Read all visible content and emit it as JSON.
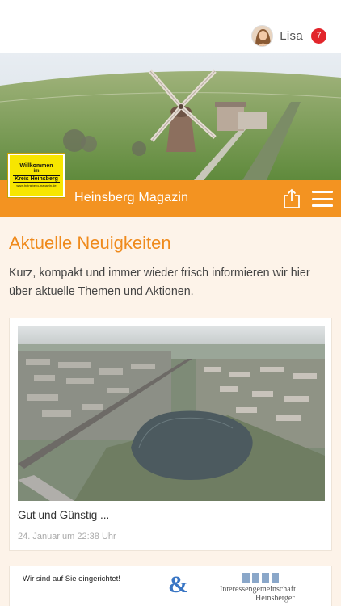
{
  "user": {
    "name": "Lisa",
    "notifications": "7"
  },
  "header": {
    "title": "Heinsberg Magazin",
    "logo": {
      "line1": "Willkommen",
      "line2": "im",
      "line3": "Kreis Heinsberg",
      "line4": "www.heinsberg-magazin.de"
    }
  },
  "section": {
    "title": "Aktuelle Neuigkeiten",
    "intro": "Kurz, kompakt und immer wieder frisch informieren wir hier über aktuelle Themen und Aktionen."
  },
  "articles": [
    {
      "title": "Gut und Günstig ...",
      "date": "24. Januar um 22:38 Uhr"
    }
  ],
  "ad": {
    "text": "Wir sind auf Sie eingerichtet!",
    "symbol": "&",
    "org_line1": "Interessengemeinschaft",
    "org_line2": "Heinsberger"
  },
  "colors": {
    "accent": "#f39321",
    "title": "#ef8a1c",
    "badge": "#e2252b",
    "background": "#fdf3e9"
  }
}
